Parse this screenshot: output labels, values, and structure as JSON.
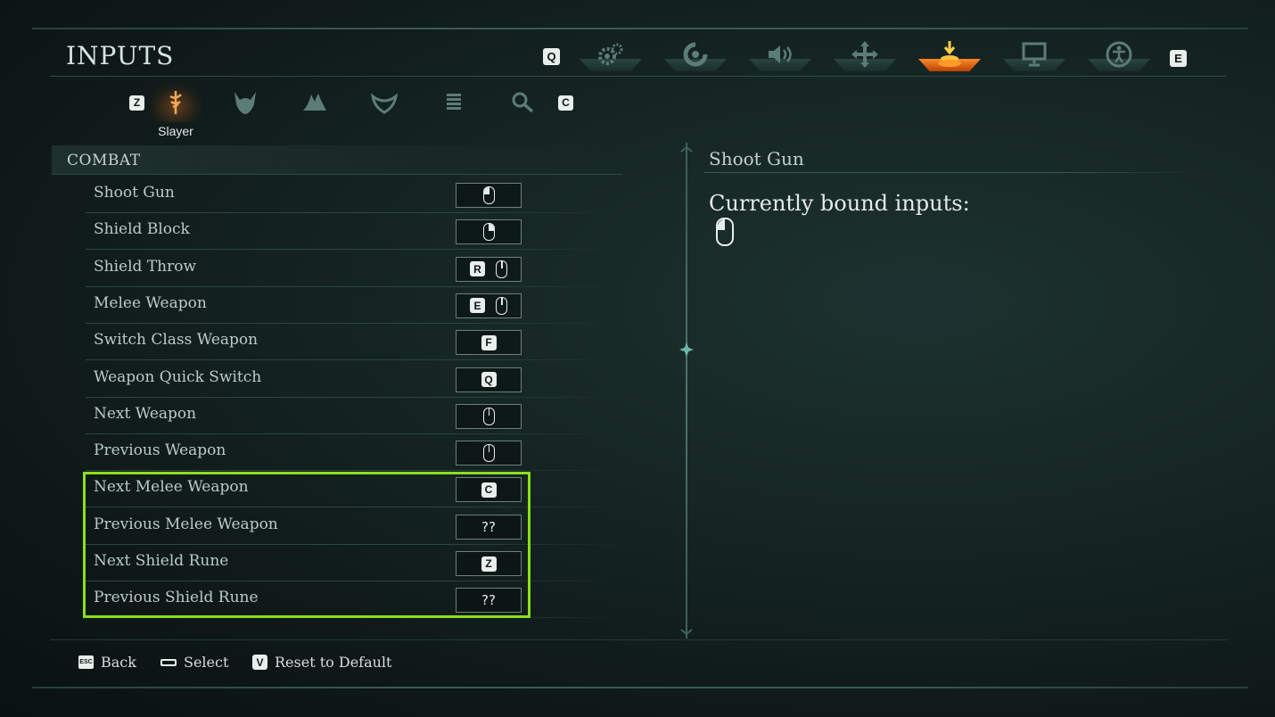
{
  "header": {
    "title": "INPUTS",
    "prev_key": "Q",
    "next_key": "E",
    "tabs": [
      {
        "icon": "gear-icon"
      },
      {
        "icon": "controller-icon"
      },
      {
        "icon": "speaker-icon"
      },
      {
        "icon": "move-arrows-icon"
      },
      {
        "icon": "input-download-icon",
        "active": true
      },
      {
        "icon": "monitor-icon"
      },
      {
        "icon": "accessibility-icon"
      }
    ],
    "accent": "#ff7a1a"
  },
  "subtabs": {
    "prev_key": "Z",
    "next_key": "C",
    "active_label": "Slayer",
    "items": [
      {
        "icon": "slayer-icon",
        "active": true
      },
      {
        "icon": "demon-helmet-icon"
      },
      {
        "icon": "dragon-icon"
      },
      {
        "icon": "shield-crest-icon"
      },
      {
        "icon": "list-icon"
      },
      {
        "icon": "magnifier-icon"
      }
    ]
  },
  "section": {
    "title": "COMBAT"
  },
  "bindings": [
    {
      "label": "Shoot Gun",
      "keys": [
        "mouse-left"
      ]
    },
    {
      "label": "Shield Block",
      "keys": [
        "mouse-right"
      ]
    },
    {
      "label": "Shield Throw",
      "keys": [
        "R",
        "mouse-none"
      ]
    },
    {
      "label": "Melee Weapon",
      "keys": [
        "E",
        "mouse-4"
      ]
    },
    {
      "label": "Switch Class Weapon",
      "keys": [
        "F"
      ]
    },
    {
      "label": "Weapon Quick Switch",
      "keys": [
        "Q"
      ]
    },
    {
      "label": "Next Weapon",
      "keys": [
        "wheel-up"
      ]
    },
    {
      "label": "Previous Weapon",
      "keys": [
        "wheel-down"
      ]
    },
    {
      "label": "Next Melee Weapon",
      "keys": [
        "C"
      ]
    },
    {
      "label": "Previous Melee Weapon",
      "keys": [
        "??"
      ]
    },
    {
      "label": "Next Shield Rune",
      "keys": [
        "Z"
      ]
    },
    {
      "label": "Previous Shield Rune",
      "keys": [
        "??"
      ]
    }
  ],
  "highlight_color": "#8bdf1d",
  "detail": {
    "title": "Shoot Gun",
    "bound_label": "Currently bound inputs:"
  },
  "footer": {
    "back_key": "ESC",
    "back_label": "Back",
    "select_label": "Select",
    "reset_key": "V",
    "reset_label": "Reset to Default"
  }
}
